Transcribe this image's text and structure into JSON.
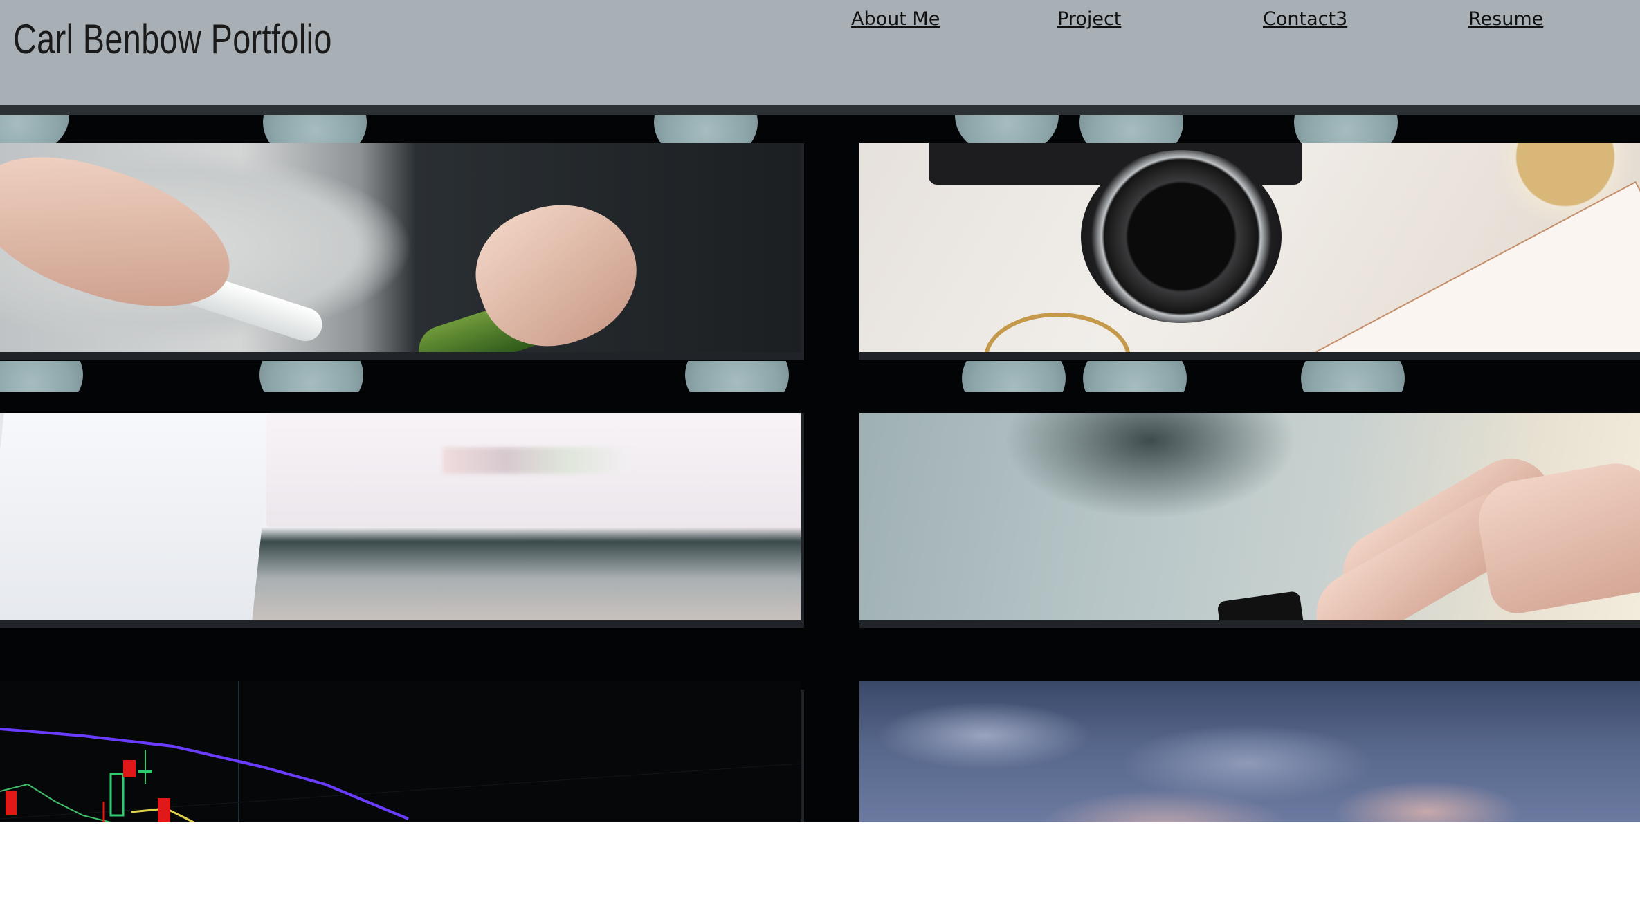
{
  "header": {
    "title": "Carl Benbow Portfolio",
    "nav": [
      {
        "label": "About Me"
      },
      {
        "label": "Project"
      },
      {
        "label": "Contact3"
      },
      {
        "label": "Resume"
      }
    ],
    "background_color": "#a9b0b5"
  },
  "gallery": {
    "background_color": "#030405",
    "tiles": [
      {
        "subject": "hands slicing a zucchini"
      },
      {
        "subject": "camera on a desk with notepad"
      },
      {
        "subject": "blurred laptop and monitor"
      },
      {
        "subject": "hand touching a smartwatch"
      },
      {
        "subject": "candlestick stock chart"
      },
      {
        "subject": "cloudy evening sky"
      }
    ]
  }
}
